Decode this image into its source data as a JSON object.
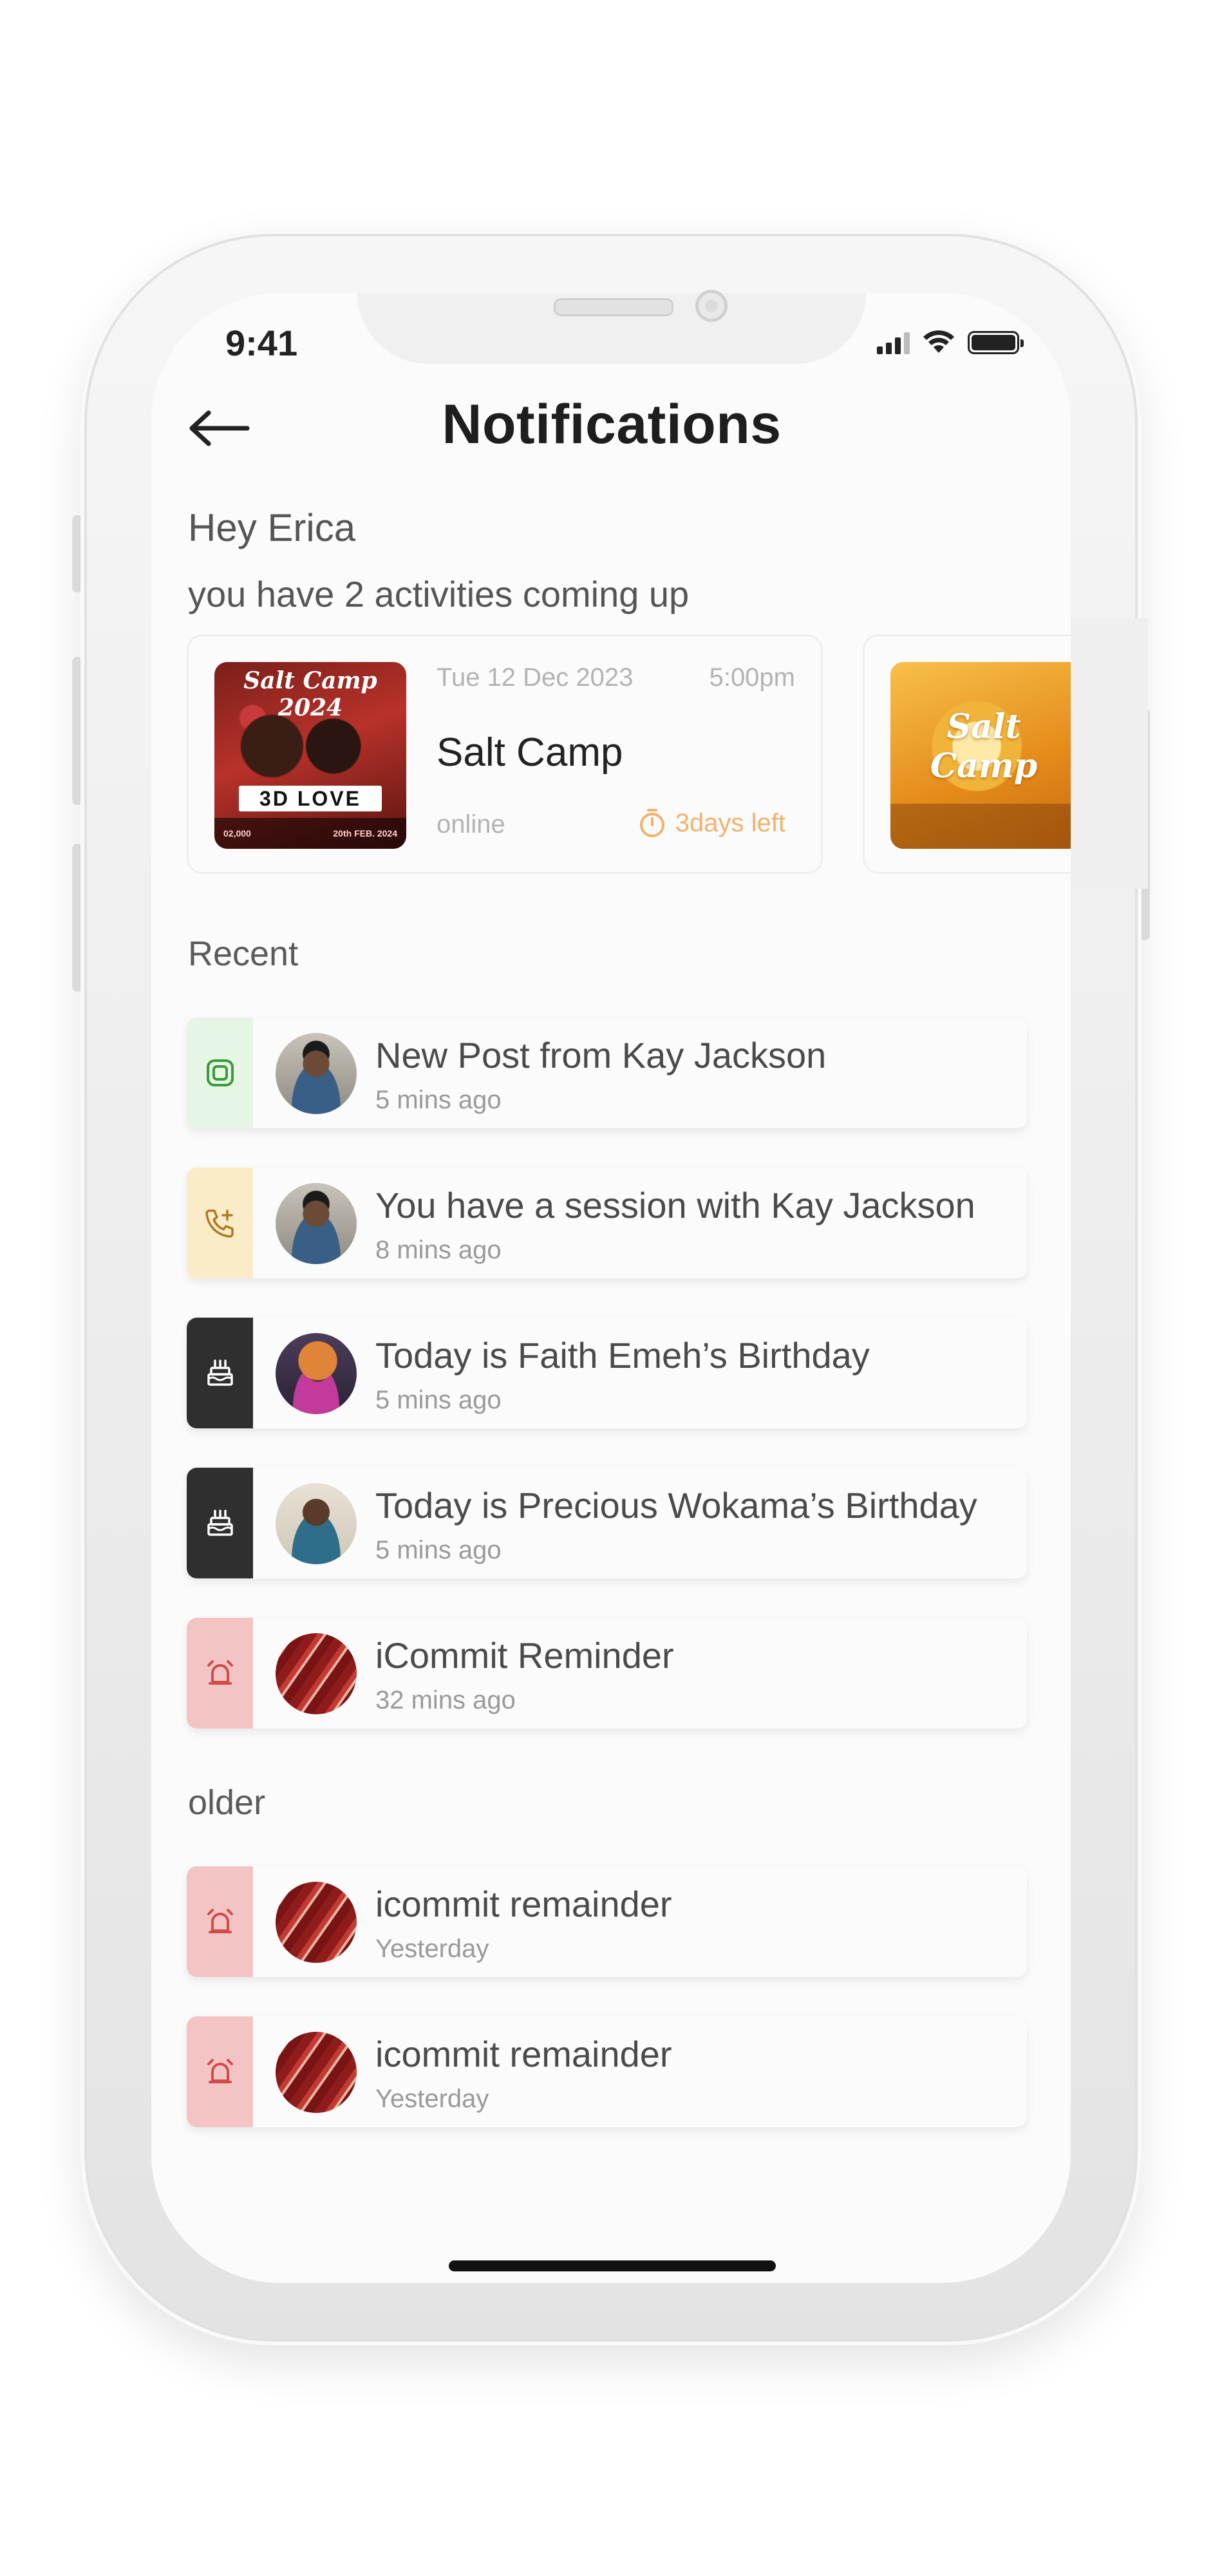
{
  "status_bar": {
    "time": "9:41"
  },
  "header": {
    "title": "Notifications",
    "back_icon": "arrow-left-icon"
  },
  "greeting": {
    "line1": "Hey Erica",
    "line2": "you have 2 activities coming up"
  },
  "activities": [
    {
      "poster_text_top": "Salt Camp 2024",
      "poster_text_mid": "3D LOVE",
      "poster_text_left": "02,000",
      "poster_text_right": "20th FEB. 2024",
      "date": "Tue 12 Dec 2023",
      "time": "5:00pm",
      "title": "Salt Camp",
      "mode": "online",
      "countdown": "3days left"
    },
    {
      "poster_text_logo": "Salt Camp"
    }
  ],
  "sections": {
    "recent_label": "Recent",
    "older_label": "older"
  },
  "colors": {
    "badge_post": "#e6f6e4",
    "badge_post_icon": "#3c9a3c",
    "badge_session": "#faecc8",
    "badge_session_icon": "#b07a20",
    "badge_birthday": "#2f2f2f",
    "badge_birthday_icon": "#ffffff",
    "badge_reminder": "#f4c4c4",
    "badge_reminder_icon": "#d24a4a",
    "countdown": "#f4b16b"
  },
  "recent": [
    {
      "icon": "post-icon",
      "title": "New Post from Kay Jackson",
      "time": "5 mins ago"
    },
    {
      "icon": "phone-add-icon",
      "title": "You have a session with Kay Jackson",
      "time": "8 mins ago"
    },
    {
      "icon": "cake-icon",
      "title": "Today is Faith Emeh’s Birthday",
      "time": "5 mins ago"
    },
    {
      "icon": "cake-icon",
      "title": "Today is Precious Wokama’s Birthday",
      "time": "5 mins ago"
    },
    {
      "icon": "alarm-icon",
      "title": "iCommit Reminder",
      "time": "32 mins ago"
    }
  ],
  "older": [
    {
      "icon": "alarm-icon",
      "title": "icommit remainder",
      "time": "Yesterday"
    },
    {
      "icon": "alarm-icon",
      "title": "icommit remainder",
      "time": "Yesterday"
    }
  ]
}
